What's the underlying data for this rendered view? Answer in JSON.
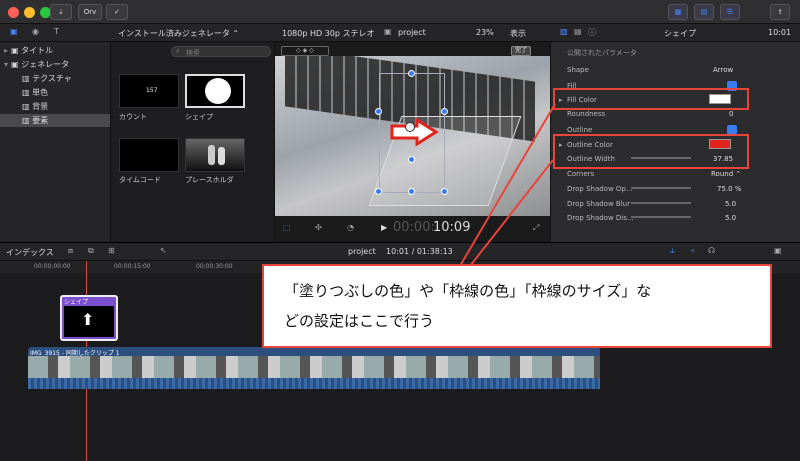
{
  "window": {
    "toolbar_tag": "Orv"
  },
  "toolbar": {
    "generator_menu": "インストール済みジェネレータ ⌃",
    "format": "1080p HD 30p ステレオ",
    "project": "project",
    "zoom": "23%",
    "view": "表示",
    "inspector_title": "シェイプ",
    "inspector_time": "10:01"
  },
  "sidebar": {
    "items": [
      {
        "label": "タイトル"
      },
      {
        "label": "ジェネレータ"
      },
      {
        "label": "テクスチャ"
      },
      {
        "label": "単色"
      },
      {
        "label": "背景"
      },
      {
        "label": "要素"
      }
    ]
  },
  "browser": {
    "search_placeholder": "検索",
    "items": [
      {
        "label": "カウント",
        "preview": "157"
      },
      {
        "label": "シェイプ"
      },
      {
        "label": "タイムコード"
      },
      {
        "label": "プレースホルダ"
      }
    ]
  },
  "viewer": {
    "done_label": "完了",
    "timecode_dim": "00:00:",
    "timecode": "10:09"
  },
  "inspector": {
    "section": "公開されたパラメータ",
    "rows": [
      {
        "label": "Shape",
        "value": "Arrow"
      },
      {
        "label": "Fill"
      },
      {
        "label": "Fill Color"
      },
      {
        "label": "Roundness",
        "value": "0"
      },
      {
        "label": "Outline"
      },
      {
        "label": "Outline Color"
      },
      {
        "label": "Outline Width",
        "value": "37.85"
      },
      {
        "label": "Corners",
        "value": "Round ⌃"
      },
      {
        "label": "Drop Shadow Op...",
        "value": "75.0 %"
      },
      {
        "label": "Drop Shadow Blur",
        "value": "5.0"
      },
      {
        "label": "Drop Shadow Dis...",
        "value": "5.0"
      }
    ],
    "colors": {
      "fill": "#ffffff",
      "outline": "#e0241c"
    }
  },
  "timeline": {
    "index": "インデックス",
    "project": "project",
    "time": "10:01 / 01:38:13",
    "ruler": [
      "00:00:00:00",
      "00:00:15:00",
      "00:00:30:00"
    ],
    "shape_clip": "シェイプ",
    "video_clip": "IMG_3915 - 同期したクリップ 1"
  },
  "callout": {
    "line1": "「塗りつぶしの色」や「枠線の色」「枠線のサイズ」な",
    "line2": "どの設定はここで行う"
  }
}
